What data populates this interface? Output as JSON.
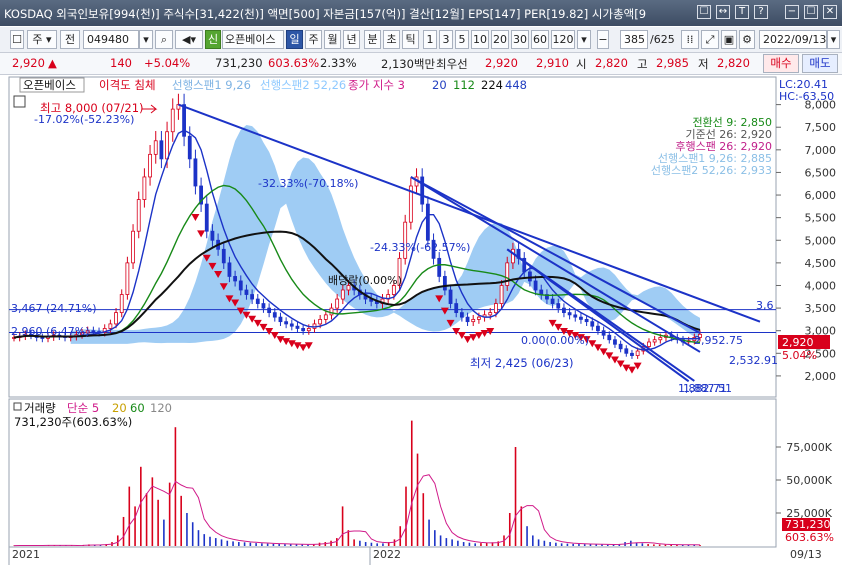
{
  "window": {
    "title": "KOSDAQ 외국인보유[994(천)] 주식수[31,422(천)] 액면[500] 자본금[157(억)] 결산[12월] EPS[147] PER[19.82] 시가총액[9",
    "buttons": [
      "☐",
      "↔",
      "T",
      "?",
      "−",
      "☐",
      "✕"
    ]
  },
  "toolbar": {
    "stock_type": "주",
    "period_label": "전",
    "code": "049480",
    "market_badge": "신",
    "stock_name": "오픈베이스",
    "periods": [
      "일",
      "주",
      "월",
      "년",
      "분",
      "초",
      "틱"
    ],
    "active_period": "일",
    "intervals": [
      "1",
      "3",
      "5",
      "10",
      "20",
      "30",
      "60",
      "120"
    ],
    "count": "385",
    "count_total": "/625",
    "date": "2022/09/13"
  },
  "price": {
    "last": "2,920",
    "arrow": "▲",
    "change": "140",
    "change_pct": "+5.04%",
    "volume": "731,230",
    "volume_ratio": "603.63%",
    "turnover": "2.33%",
    "amount": "2,130백만",
    "best_ask_label": "최우선",
    "best_ask": "2,920",
    "best_bid": "2,910",
    "open_label": "시",
    "open": "2,820",
    "high_label": "고",
    "high": "2,985",
    "low_label": "저",
    "low": "2,820",
    "buy_label": "매수",
    "sell_label": "매도"
  },
  "chart_data": [
    {
      "type": "candlestick",
      "title": "오픈베이스",
      "legend": [
        "이격도 침체",
        "선행스팬1 9,26",
        "선행스팬2 52,26",
        "종가 지수 3",
        "20",
        "112",
        "224",
        "448"
      ],
      "legend_colors": [
        "#d8001b",
        "#7fb3e3",
        "#8ec9ff",
        "#d01b8a",
        "#2440c0",
        "#188a18",
        "#111111",
        "#2440c0"
      ],
      "lc_label": "LC:20.41",
      "hc_label": "HC:-63.50",
      "ichimoku_labels": [
        {
          "text": "전환선 9: 2,850",
          "color": "#188a18"
        },
        {
          "text": "기준선 26: 2,920",
          "color": "#555555"
        },
        {
          "text": "후행스팬 26: 2,920",
          "color": "#c0208a"
        },
        {
          "text": "선행스팬1 9,26: 2,885",
          "color": "#8bbfe6"
        },
        {
          "text": "선행스팬2 52,26: 2,933",
          "color": "#8bbfe6"
        }
      ],
      "y_ticks": [
        2000,
        2500,
        3000,
        3500,
        4000,
        4500,
        5000,
        5500,
        6000,
        6500,
        7000,
        7500,
        8000
      ],
      "ylim": [
        1600,
        8500
      ],
      "x_labels": [
        "2021",
        "2022",
        "09/13"
      ],
      "annotations": {
        "high": "최고 8,000 (07/21)",
        "high_pct": "-17.02%(-52.23%)",
        "low": "최저 2,425 (06/23)",
        "trend1": "-32.33%(-70.18%)",
        "trend2": "-24.33%(-62.57%)",
        "dividend": "배당락(0.00%)",
        "level1": "3,467 (24.71%)",
        "level2": "2,960 (6.47%)",
        "level3": "0.00(0.00%)",
        "line_values": [
          "3,6",
          "2,952.75",
          "2,532.91",
          "1,882.71",
          "1,887.51"
        ],
        "last_price_badge": "2,920",
        "last_pct": "5.04%"
      },
      "close_series": [
        2850,
        2880,
        2920,
        2900,
        2850,
        2830,
        2860,
        2900,
        2880,
        2850,
        2870,
        2910,
        2950,
        3000,
        2980,
        2960,
        3050,
        3150,
        3400,
        3800,
        4500,
        5200,
        5900,
        6400,
        6900,
        7200,
        6800,
        7400,
        7900,
        8000,
        7300,
        6800,
        6200,
        5800,
        5200,
        5000,
        4800,
        4500,
        4200,
        4100,
        3900,
        3800,
        3700,
        3600,
        3500,
        3400,
        3300,
        3200,
        3150,
        3100,
        3050,
        3000,
        3050,
        3150,
        3250,
        3350,
        3500,
        3700,
        3900,
        4000,
        3900,
        3800,
        3700,
        3650,
        3600,
        3700,
        3800,
        4000,
        4600,
        5400,
        6200,
        6400,
        5800,
        5000,
        4600,
        4200,
        3900,
        3600,
        3400,
        3300,
        3200,
        3250,
        3300,
        3350,
        3400,
        3600,
        4000,
        4500,
        4800,
        4600,
        4300,
        4100,
        3900,
        3800,
        3700,
        3600,
        3500,
        3400,
        3350,
        3300,
        3250,
        3200,
        3100,
        3000,
        2900,
        2800,
        2700,
        2600,
        2500,
        2450,
        2550,
        2650,
        2750,
        2800,
        2850,
        2900,
        2850,
        2800,
        2750,
        2780,
        2850,
        2920
      ]
    },
    {
      "type": "bar",
      "title": "거래량",
      "legend": [
        "단순 5",
        "20",
        "60",
        "120"
      ],
      "legend_colors": [
        "#d01b8a",
        "#c8a000",
        "#188a18",
        "#888888"
      ],
      "current_label": "731,230주(603.63%)",
      "y_ticks": [
        25000,
        50000,
        75000
      ],
      "y_tick_labels": [
        "25,000K",
        "50,000K",
        "75,000K"
      ],
      "ylim": [
        0,
        100000
      ],
      "volume_badge": "731,230",
      "volume_pct_badge": "603.63%",
      "values": [
        300,
        400,
        500,
        350,
        300,
        400,
        600,
        500,
        400,
        300,
        350,
        500,
        800,
        1200,
        900,
        700,
        1500,
        3000,
        8000,
        22000,
        45000,
        30000,
        60000,
        40000,
        52000,
        35000,
        20000,
        48000,
        90000,
        38000,
        25000,
        18000,
        12000,
        9000,
        7000,
        6000,
        5000,
        4000,
        3500,
        3000,
        2800,
        2500,
        2200,
        2000,
        1800,
        1600,
        1500,
        1400,
        1300,
        1200,
        1100,
        1000,
        1500,
        2500,
        3000,
        4000,
        6000,
        30000,
        12000,
        5000,
        4000,
        3000,
        2500,
        2000,
        2000,
        3000,
        5000,
        15000,
        45000,
        95000,
        70000,
        40000,
        20000,
        12000,
        8000,
        6000,
        5000,
        4000,
        3000,
        2500,
        2000,
        2200,
        2500,
        2800,
        3500,
        8000,
        25000,
        75000,
        30000,
        15000,
        8000,
        5000,
        4000,
        3000,
        2500,
        2000,
        1800,
        1600,
        1500,
        1400,
        1300,
        1200,
        1100,
        1000,
        1200,
        1500,
        3000,
        4000,
        2500,
        2000,
        1500,
        1200,
        1100,
        1000,
        1000,
        900,
        800,
        900,
        1000,
        731
      ]
    }
  ]
}
